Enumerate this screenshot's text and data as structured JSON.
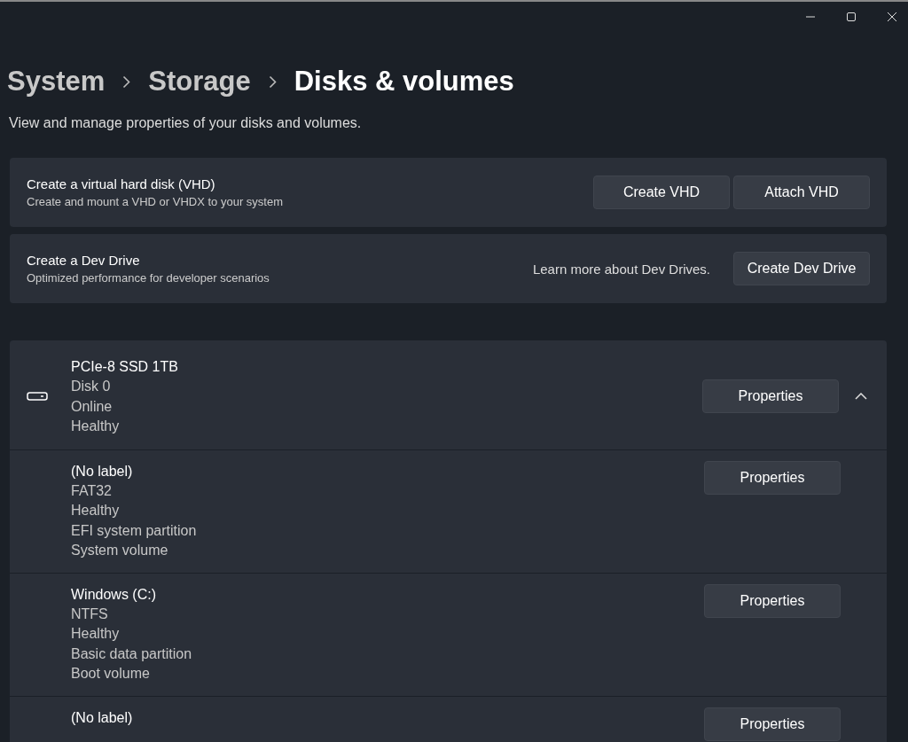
{
  "breadcrumb": [
    {
      "label": "System",
      "current": false
    },
    {
      "label": "Storage",
      "current": false
    },
    {
      "label": "Disks & volumes",
      "current": true
    }
  ],
  "description": "View and manage properties of your disks and volumes.",
  "cards": [
    {
      "title": "Create a virtual hard disk (VHD)",
      "subtitle": "Create and mount a VHD or VHDX to your system",
      "buttons": [
        "Create VHD",
        "Attach VHD"
      ]
    },
    {
      "title": "Create a Dev Drive",
      "subtitle": "Optimized performance for developer scenarios",
      "link": "Learn more about Dev Drives.",
      "buttons": [
        "Create Dev Drive"
      ]
    }
  ],
  "disk": {
    "name": "PCIe-8 SSD 1TB",
    "details": [
      "Disk 0",
      "Online",
      "Healthy"
    ],
    "button": "Properties",
    "expanded": true,
    "volumes": [
      {
        "name": "(No label)",
        "details": [
          "FAT32",
          "Healthy",
          "EFI system partition",
          "System volume"
        ],
        "button": "Properties"
      },
      {
        "name": "Windows (C:)",
        "details": [
          "NTFS",
          "Healthy",
          "Basic data partition",
          "Boot volume"
        ],
        "button": "Properties"
      },
      {
        "name": "(No label)",
        "button": "Properties"
      }
    ]
  }
}
